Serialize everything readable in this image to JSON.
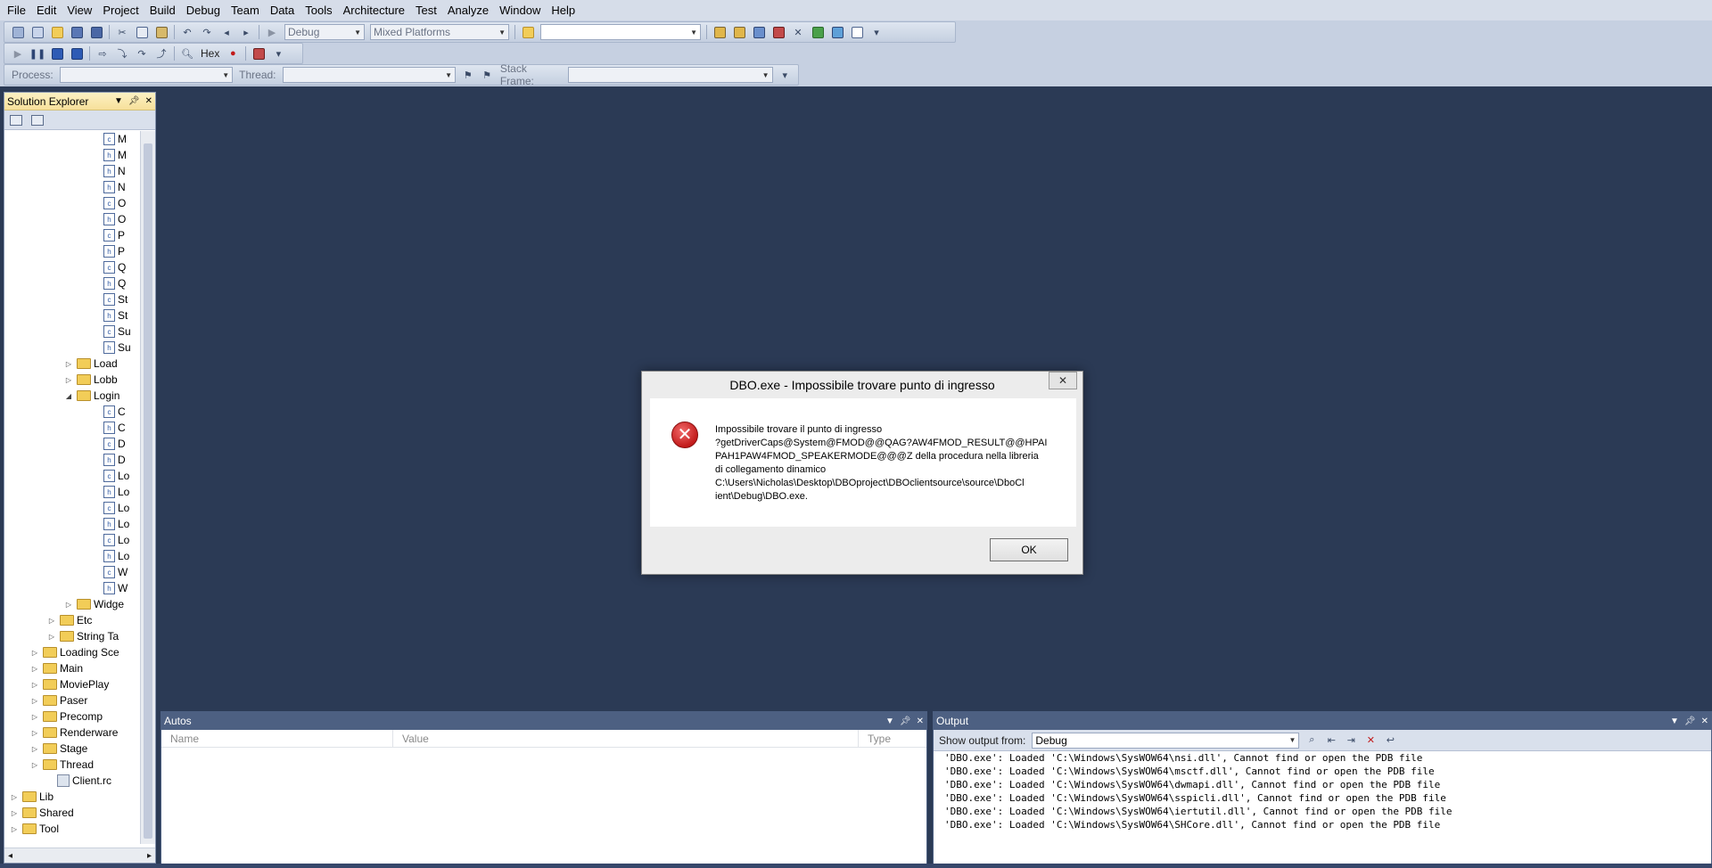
{
  "menu": [
    "File",
    "Edit",
    "View",
    "Project",
    "Build",
    "Debug",
    "Team",
    "Data",
    "Tools",
    "Architecture",
    "Test",
    "Analyze",
    "Window",
    "Help"
  ],
  "toolbar": {
    "config": "Debug",
    "platform": "Mixed Platforms",
    "hex_label": "Hex",
    "process_label": "Process:",
    "thread_label": "Thread:",
    "stack_frame_label": "Stack Frame:"
  },
  "solution_explorer": {
    "title": "Solution Explorer",
    "files": [
      {
        "icon": "c++",
        "label": "M"
      },
      {
        "icon": "h",
        "label": "M"
      },
      {
        "icon": "h",
        "label": "N"
      },
      {
        "icon": "h",
        "label": "N"
      },
      {
        "icon": "c++",
        "label": "O"
      },
      {
        "icon": "h",
        "label": "O"
      },
      {
        "icon": "c++",
        "label": "P"
      },
      {
        "icon": "h",
        "label": "P"
      },
      {
        "icon": "c++",
        "label": "Q"
      },
      {
        "icon": "h",
        "label": "Q"
      },
      {
        "icon": "c++",
        "label": "St"
      },
      {
        "icon": "h",
        "label": "St"
      },
      {
        "icon": "c++",
        "label": "Su"
      },
      {
        "icon": "h",
        "label": "Su"
      }
    ],
    "mid_folders": [
      "Load",
      "Lobb",
      "Login"
    ],
    "login_files": [
      {
        "icon": "c++",
        "label": "C"
      },
      {
        "icon": "h",
        "label": "C"
      },
      {
        "icon": "c++",
        "label": "D"
      },
      {
        "icon": "h",
        "label": "D"
      },
      {
        "icon": "c++",
        "label": "Lo"
      },
      {
        "icon": "h",
        "label": "Lo"
      },
      {
        "icon": "c++",
        "label": "Lo"
      },
      {
        "icon": "h",
        "label": "Lo"
      },
      {
        "icon": "c++",
        "label": "Lo"
      },
      {
        "icon": "h",
        "label": "Lo"
      },
      {
        "icon": "c++",
        "label": "W"
      },
      {
        "icon": "h",
        "label": "W"
      }
    ],
    "widget_folder": "Widge",
    "level2_folders": [
      "Etc",
      "String Ta"
    ],
    "level1_folders": [
      "Loading Sce",
      "Main",
      "MoviePlay",
      "Paser",
      "Precomp",
      "Renderware",
      "Stage",
      "Thread"
    ],
    "rc_file": "Client.rc",
    "root_folders": [
      "Lib",
      "Shared",
      "Tool"
    ]
  },
  "autos": {
    "title": "Autos",
    "columns": [
      "Name",
      "Value",
      "Type"
    ]
  },
  "output": {
    "title": "Output",
    "show_from_label": "Show output from:",
    "show_from_value": "Debug",
    "lines": [
      "'DBO.exe': Loaded 'C:\\Windows\\SysWOW64\\nsi.dll', Cannot find or open the PDB file",
      "'DBO.exe': Loaded 'C:\\Windows\\SysWOW64\\msctf.dll', Cannot find or open the PDB file",
      "'DBO.exe': Loaded 'C:\\Windows\\SysWOW64\\dwmapi.dll', Cannot find or open the PDB file",
      "'DBO.exe': Loaded 'C:\\Windows\\SysWOW64\\sspicli.dll', Cannot find or open the PDB file",
      "'DBO.exe': Loaded 'C:\\Windows\\SysWOW64\\iertutil.dll', Cannot find or open the PDB file",
      "'DBO.exe': Loaded 'C:\\Windows\\SysWOW64\\SHCore.dll', Cannot find or open the PDB file"
    ]
  },
  "dialog": {
    "title": "DBO.exe - Impossibile trovare punto di ingresso",
    "close": "✕",
    "message": [
      "Impossibile trovare il punto di ingresso",
      "?getDriverCaps@System@FMOD@@QAG?AW4FMOD_RESULT@@HPAI",
      "PAH1PAW4FMOD_SPEAKERMODE@@@Z della procedura nella libreria",
      "di collegamento dinamico",
      "C:\\Users\\Nicholas\\Desktop\\DBOproject\\DBOclientsource\\source\\DboCl",
      "ient\\Debug\\DBO.exe."
    ],
    "ok_label": "OK"
  },
  "colors": {
    "workspace": "#2b3a55",
    "chrome": "#d6dde9",
    "panel_title_active": "#f7e09a",
    "panel_title_inactive": "#4d6082",
    "error_red": "#c21b1b"
  }
}
